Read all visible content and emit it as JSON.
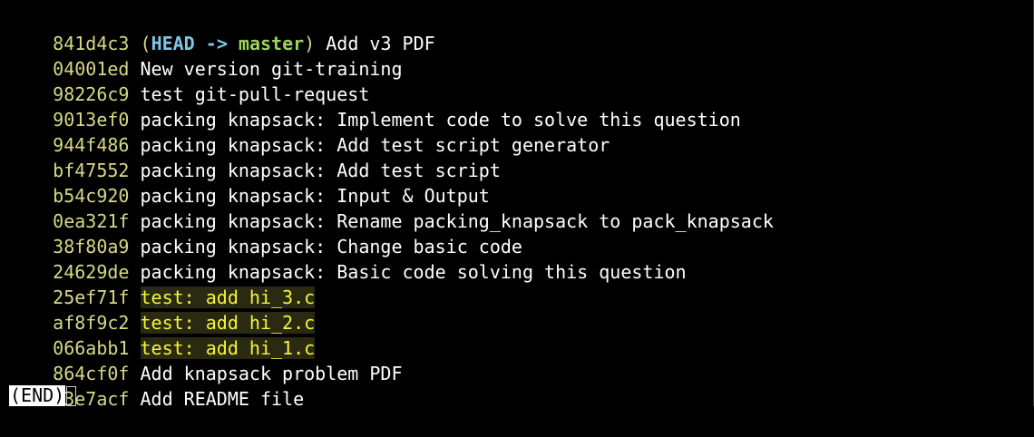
{
  "commits": [
    {
      "hash": "841d4c3",
      "ref_open": "(",
      "ref_head": "HEAD",
      "ref_arrow": " -> ",
      "ref_branch": "master",
      "ref_close": ")",
      "message": "Add v3 PDF",
      "highlighted": false
    },
    {
      "hash": "04001ed",
      "message": "New version git-training",
      "highlighted": false
    },
    {
      "hash": "98226c9",
      "message": "test git-pull-request",
      "highlighted": false
    },
    {
      "hash": "9013ef0",
      "message": "packing knapsack: Implement code to solve this question",
      "highlighted": false
    },
    {
      "hash": "944f486",
      "message": "packing knapsack: Add test script generator",
      "highlighted": false
    },
    {
      "hash": "bf47552",
      "message": "packing knapsack: Add test script",
      "highlighted": false
    },
    {
      "hash": "b54c920",
      "message": "packing knapsack: Input & Output",
      "highlighted": false
    },
    {
      "hash": "0ea321f",
      "message": "packing knapsack: Rename packing_knapsack to pack_knapsack",
      "highlighted": false
    },
    {
      "hash": "38f80a9",
      "message": "packing knapsack: Change basic code",
      "highlighted": false
    },
    {
      "hash": "24629de",
      "message": "packing knapsack: Basic code solving this question",
      "highlighted": false
    },
    {
      "hash": "25ef71f",
      "message": "test: add hi_3.c",
      "highlighted": true
    },
    {
      "hash": "af8f9c2",
      "message": "test: add hi_2.c",
      "highlighted": true
    },
    {
      "hash": "066abb1",
      "message": "test: add hi_1.c",
      "highlighted": true
    },
    {
      "hash": "864cf0f",
      "message": "Add knapsack problem PDF",
      "highlighted": false
    },
    {
      "hash": "73e7acf",
      "message": "Add README file",
      "highlighted": false
    }
  ],
  "pager": {
    "end_label": "(END)"
  },
  "colors": {
    "background": "#000000",
    "hash": "#d7d787",
    "head": "#7fc6e6",
    "branch": "#9bd35a",
    "message": "#ffffff",
    "highlight_bg": "#2a2a12",
    "highlight_fg": "#f5f536"
  }
}
